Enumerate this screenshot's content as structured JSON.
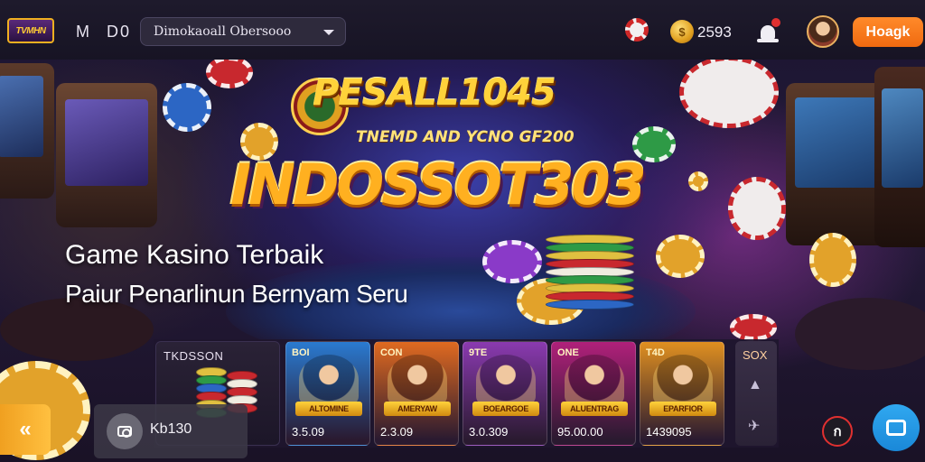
{
  "header": {
    "logo_text": "TVMHN",
    "nav_m": "M",
    "nav_d": "D0",
    "language_select": "Dimokaoall Obersooo",
    "balance": "2593",
    "coin_symbol": "$",
    "login_label": "Hoagk"
  },
  "hero": {
    "brand_top": "PESALL1045",
    "brand_sub": "TNEMD AND YCNO GF200",
    "brand_main": "INDOSSOT303",
    "title": "Game Kasino Terbaik",
    "subtitle": "Paiur Penarlinun  Bernyam Seru"
  },
  "jackpot": {
    "label": "TKDSSON"
  },
  "games": [
    {
      "tag": "BOI",
      "banner": "ALTOMINE",
      "price": "3.5.09",
      "color": "#2a7ad0"
    },
    {
      "tag": "CON",
      "banner": "AMERYAW",
      "price": "2.3.09",
      "color": "#e06a20"
    },
    {
      "tag": "9TE",
      "banner": "BOEARGOE",
      "price": "3.0.309",
      "color": "#8a3ab0"
    },
    {
      "tag": "ONE",
      "banner": "ALUENTRAG",
      "price": "95.00.00",
      "color": "#b0207a"
    },
    {
      "tag": "T4D",
      "banner": "EPARFIOR",
      "price": "1439095",
      "color": "#e09020"
    }
  ],
  "more": {
    "label": "SOX"
  },
  "bottom": {
    "back_glyph": "«",
    "search_text": "Kb130",
    "ring_label": "ก"
  }
}
